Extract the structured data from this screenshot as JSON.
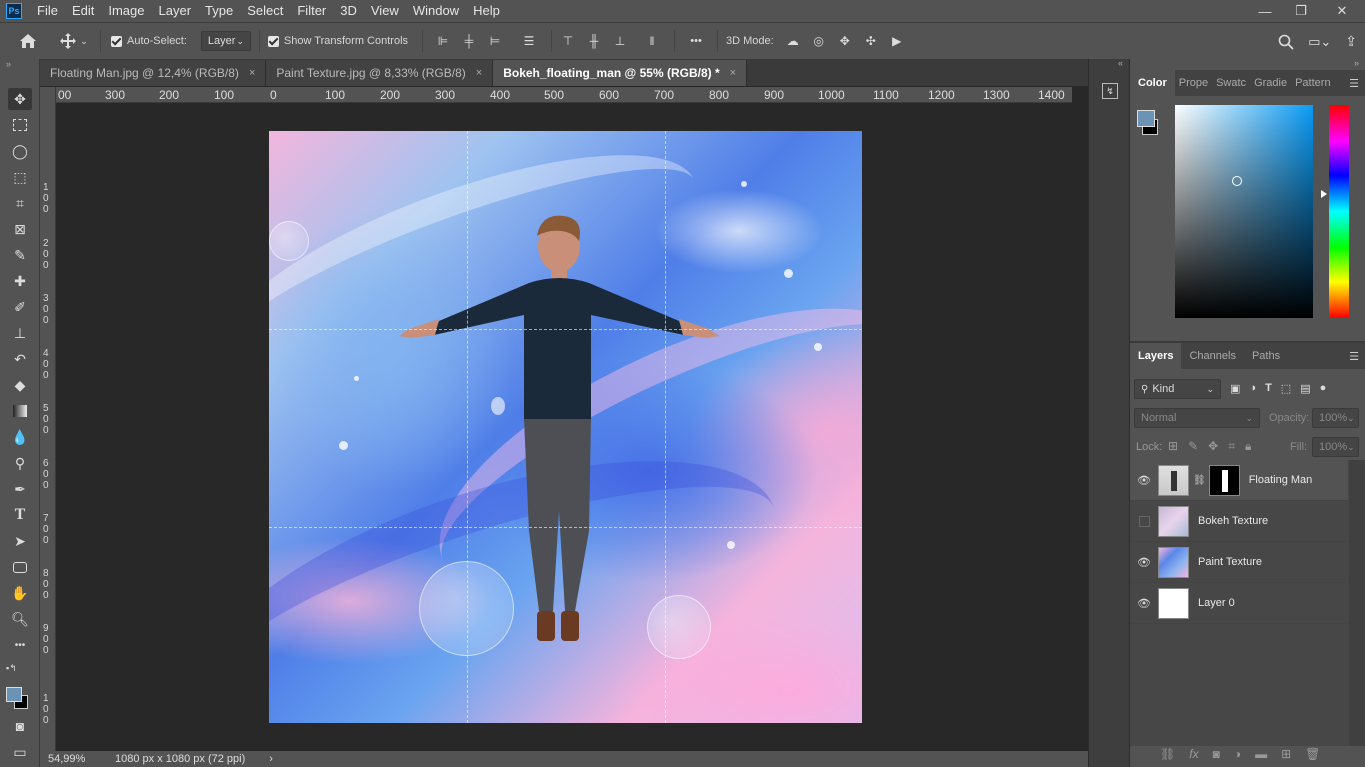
{
  "menubar": {
    "logo": "Ps",
    "items": [
      "File",
      "Edit",
      "Image",
      "Layer",
      "Type",
      "Select",
      "Filter",
      "3D",
      "View",
      "Window",
      "Help"
    ],
    "window_controls": {
      "minimize": "—",
      "restore": "❐",
      "close": "✕"
    }
  },
  "options": {
    "auto_select_label": "Auto-Select:",
    "auto_select_value": "Layer",
    "show_transform_label": "Show Transform Controls",
    "mode_3d_label": "3D Mode:",
    "more": "•••"
  },
  "tabs": [
    {
      "label": "Floating Man.jpg @ 12,4% (RGB/8)",
      "close": "×"
    },
    {
      "label": "Paint Texture.jpg @ 8,33% (RGB/8)",
      "close": "×"
    },
    {
      "label": "Bokeh_floating_man @ 55% (RGB/8) *",
      "close": "×"
    }
  ],
  "ruler_top": [
    "00",
    "300",
    "200",
    "100",
    "0",
    "100",
    "200",
    "300",
    "400",
    "500",
    "600",
    "700",
    "800",
    "900",
    "1000",
    "1100",
    "1200",
    "1300",
    "1400"
  ],
  "ruler_left": [
    {
      "chars": [
        "1",
        "0",
        "0"
      ]
    },
    {
      "chars": [
        "2",
        "0",
        "0"
      ]
    },
    {
      "chars": [
        "3",
        "0",
        "0"
      ]
    },
    {
      "chars": [
        "4",
        "0",
        "0"
      ]
    },
    {
      "chars": [
        "5",
        "0",
        "0"
      ]
    },
    {
      "chars": [
        "6",
        "0",
        "0"
      ]
    },
    {
      "chars": [
        "7",
        "0",
        "0"
      ]
    },
    {
      "chars": [
        "8",
        "0",
        "0"
      ]
    },
    {
      "chars": [
        "9",
        "0",
        "0"
      ]
    },
    {
      "chars": [
        "1",
        "0",
        "0"
      ]
    }
  ],
  "status": {
    "zoom": "54,99%",
    "doc_info": "1080 px x 1080 px (72 ppi)",
    "arrow": "›"
  },
  "color_panel": {
    "tabs": [
      "Color",
      "Prope",
      "Swatc",
      "Gradie",
      "Pattern"
    ],
    "foreground": "#6b93b5",
    "background": "#000000"
  },
  "layers_panel": {
    "tabs": [
      "Layers",
      "Channels",
      "Paths"
    ],
    "filter_kind": "Kind",
    "blend_mode": "Normal",
    "opacity_label": "Opacity:",
    "opacity_value": "100%",
    "lock_label": "Lock:",
    "fill_label": "Fill:",
    "fill_value": "100%",
    "layers": [
      {
        "name": "Floating Man",
        "visible": true
      },
      {
        "name": "Bokeh Texture",
        "visible": false
      },
      {
        "name": "Paint Texture",
        "visible": true
      },
      {
        "name": "Layer 0",
        "visible": true
      }
    ]
  }
}
